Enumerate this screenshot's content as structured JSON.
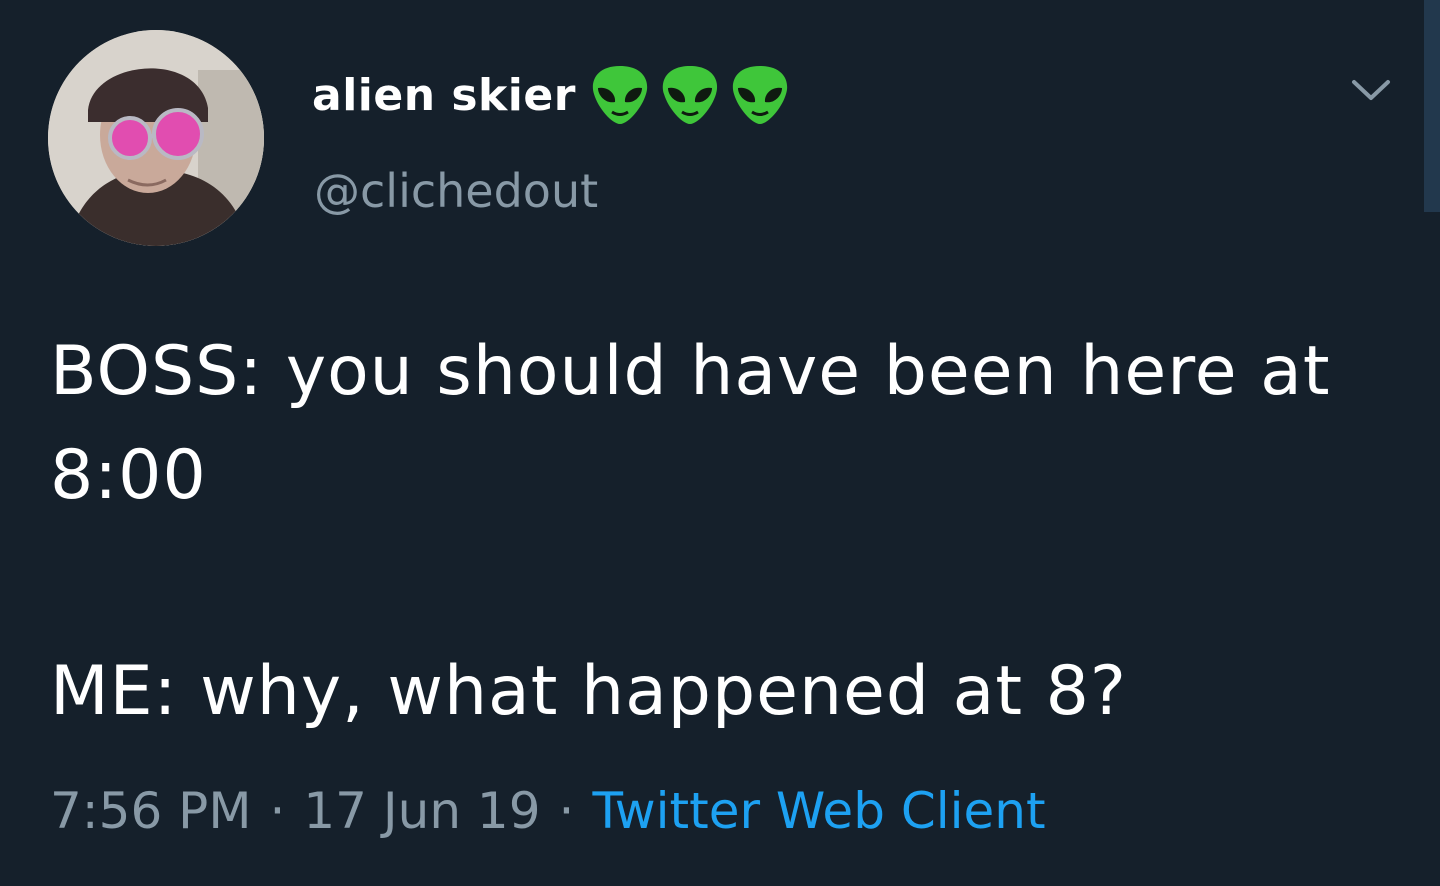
{
  "tweet": {
    "display_name": "alien skier",
    "name_emojis": [
      "alien-emoji",
      "alien-emoji",
      "alien-emoji"
    ],
    "handle": "@clichedout",
    "lines": [
      "BOSS: you should have been here at 8:00",
      "ME: why, what happened at 8?"
    ],
    "time": "7:56 PM",
    "separator": "·",
    "date": "17 Jun 19",
    "source": "Twitter Web Client"
  },
  "colors": {
    "background": "#15202b",
    "primary_text": "#ffffff",
    "secondary_text": "#8899a6",
    "link": "#1da1f2"
  }
}
